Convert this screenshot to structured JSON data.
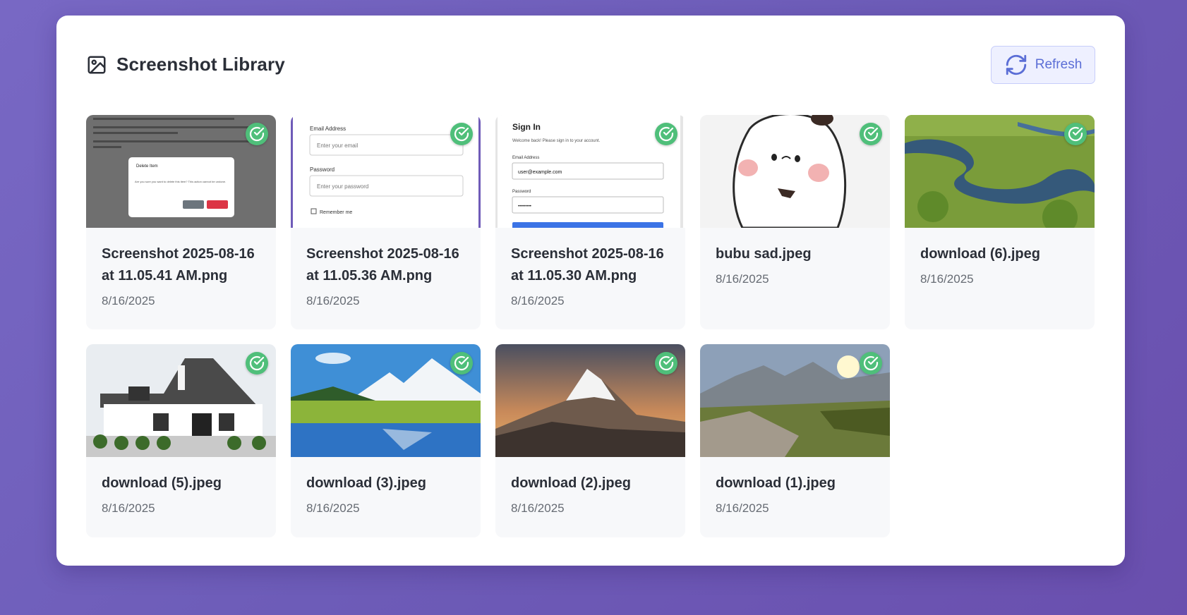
{
  "header": {
    "title": "Screenshot Library",
    "refresh_label": "Refresh"
  },
  "items": [
    {
      "name": "Screenshot 2025-08-16 at 11.05.41 AM.png",
      "date": "8/16/2025",
      "selected": true,
      "thumb": {
        "dialog_title": "Delete Item",
        "dialog_text": "Are you sure you want to delete this item? This action cannot be undone."
      }
    },
    {
      "name": "Screenshot 2025-08-16 at 11.05.36 AM.png",
      "date": "8/16/2025",
      "selected": true,
      "thumb": {
        "email_label": "Email Address",
        "email_placeholder": "Enter your email",
        "password_label": "Password",
        "password_placeholder": "Enter your password",
        "remember": "Remember me"
      }
    },
    {
      "name": "Screenshot 2025-08-16 at 11.05.30 AM.png",
      "date": "8/16/2025",
      "selected": true,
      "thumb": {
        "heading": "Sign In",
        "subtitle": "Welcome back! Please sign in to your account.",
        "email_label": "Email Address",
        "email_value": "user@example.com",
        "password_label": "Password",
        "password_value": "•••••••••"
      }
    },
    {
      "name": "bubu sad.jpeg",
      "date": "8/16/2025",
      "selected": true
    },
    {
      "name": "download (6).jpeg",
      "date": "8/16/2025",
      "selected": true
    },
    {
      "name": "download (5).jpeg",
      "date": "8/16/2025",
      "selected": true
    },
    {
      "name": "download (3).jpeg",
      "date": "8/16/2025",
      "selected": true
    },
    {
      "name": "download (2).jpeg",
      "date": "8/16/2025",
      "selected": true
    },
    {
      "name": "download (1).jpeg",
      "date": "8/16/2025",
      "selected": true
    }
  ],
  "colors": {
    "accent": "#5b6ed6",
    "check": "#4fbf7a",
    "card_bg": "#f7f8fa"
  }
}
